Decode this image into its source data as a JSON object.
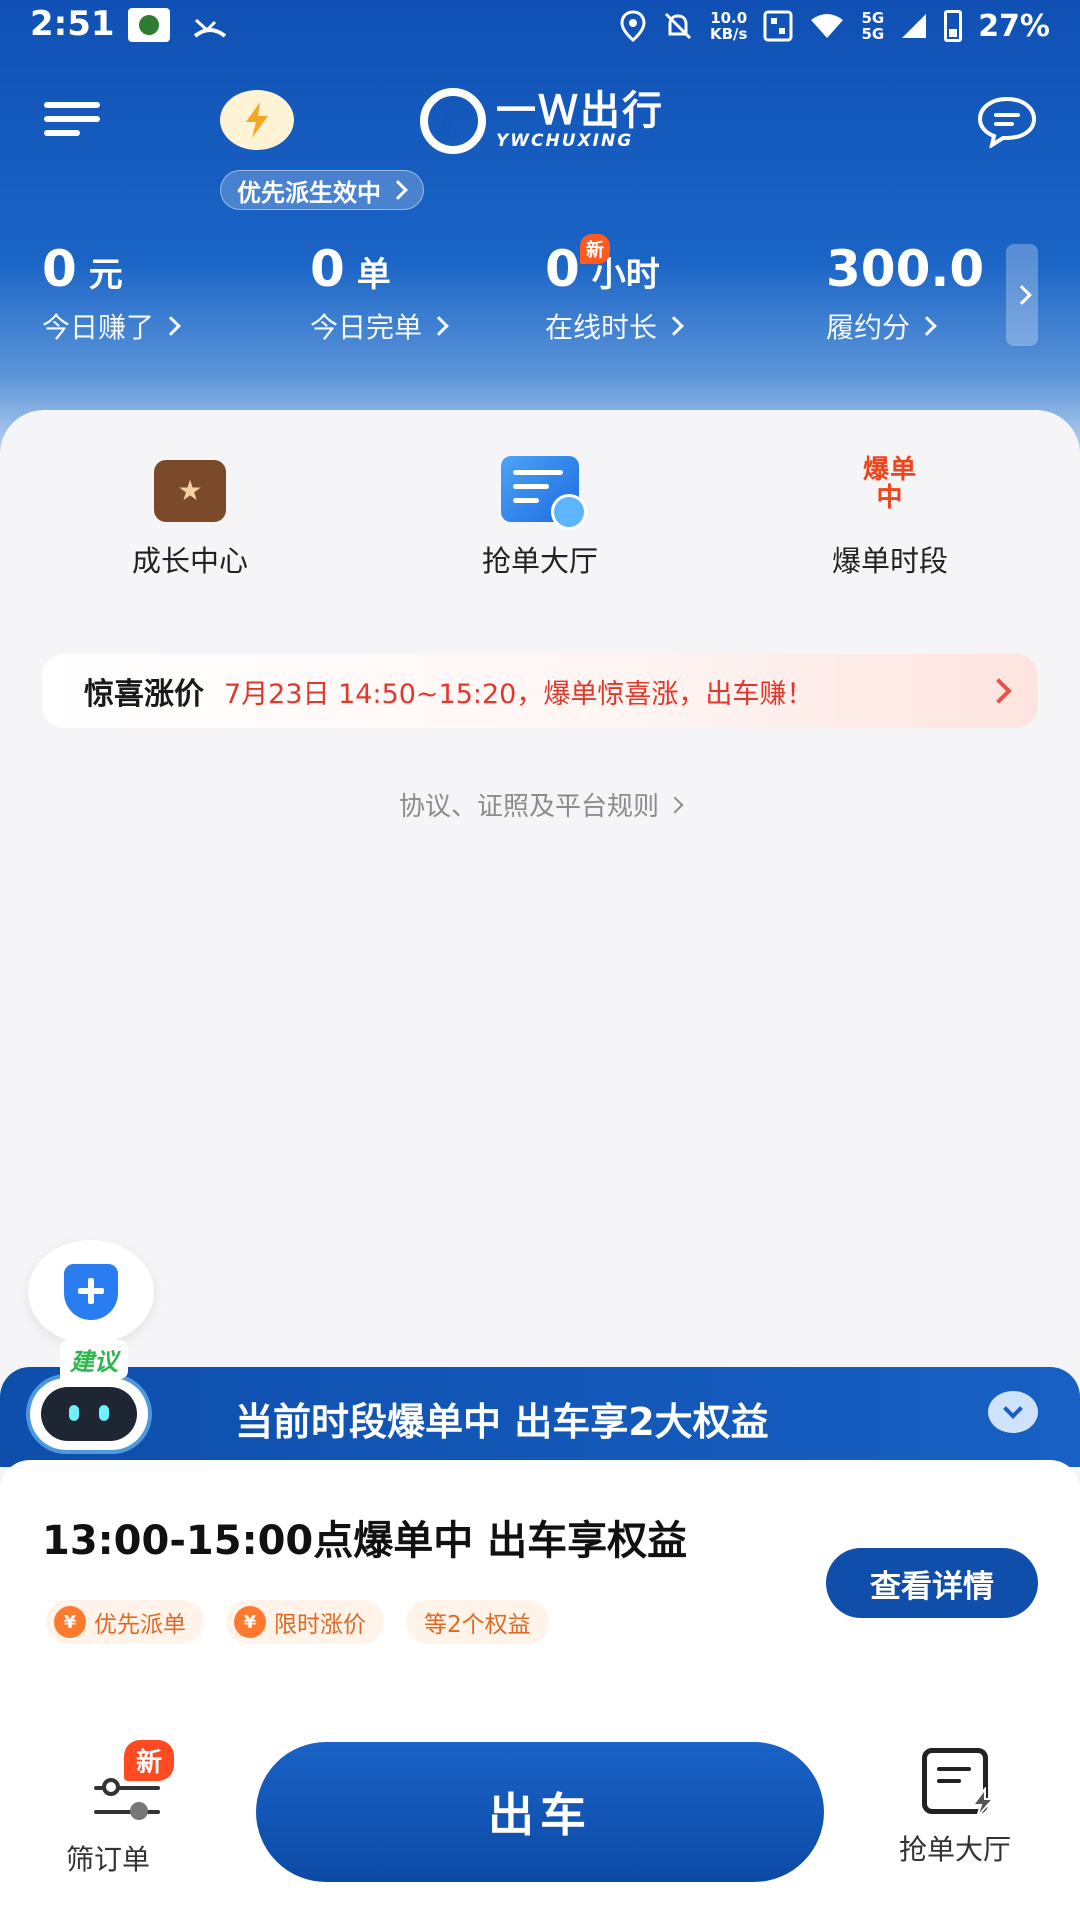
{
  "status_bar": {
    "time": "2:51",
    "net_speed_value": "10.0",
    "net_speed_unit": "KB/s",
    "signal_label_top": "5G",
    "signal_label_bottom": "5G",
    "battery": "27%"
  },
  "header": {
    "logo_cn": "一Ｗ出行",
    "logo_en": "YWCHUXING",
    "priority_pill": "优先派生效中"
  },
  "stats": [
    {
      "value": "0",
      "unit": "元",
      "label": "今日赚了"
    },
    {
      "value": "0",
      "unit": "单",
      "label": "今日完单"
    },
    {
      "value": "0",
      "unit": "小时",
      "label": "在线时长",
      "badge": "新"
    },
    {
      "value": "300.0",
      "unit": "",
      "label": "履约分"
    }
  ],
  "quick_actions": [
    {
      "label": "成长中心",
      "icon": "growth-center-icon"
    },
    {
      "label": "抢单大厅",
      "icon": "grab-order-hall-icon"
    },
    {
      "label": "爆单时段",
      "icon": "burst-period-icon",
      "icon_text_1": "爆单",
      "icon_text_2": "中"
    }
  ],
  "promo": {
    "title": "惊喜涨价",
    "text": "7月23日 14:50~15:20，爆单惊喜涨，出车赚！"
  },
  "rules_link": "协议、证照及平台规则",
  "robot_tag": "建议",
  "benefit_bar": {
    "title": "当前时段爆单中 出车享2大权益"
  },
  "info_card": {
    "title": "13:00-15:00点爆单中 出车享权益",
    "detail_button": "查看详情",
    "tags": [
      {
        "label": "优先派单",
        "icon": "¥"
      },
      {
        "label": "限时涨价",
        "icon": "¥"
      },
      {
        "label": "等2个权益"
      }
    ]
  },
  "bottom_nav": {
    "filter_label": "筛订单",
    "filter_badge": "新",
    "go_button": "出车",
    "hall_label": "抢单大厅"
  }
}
